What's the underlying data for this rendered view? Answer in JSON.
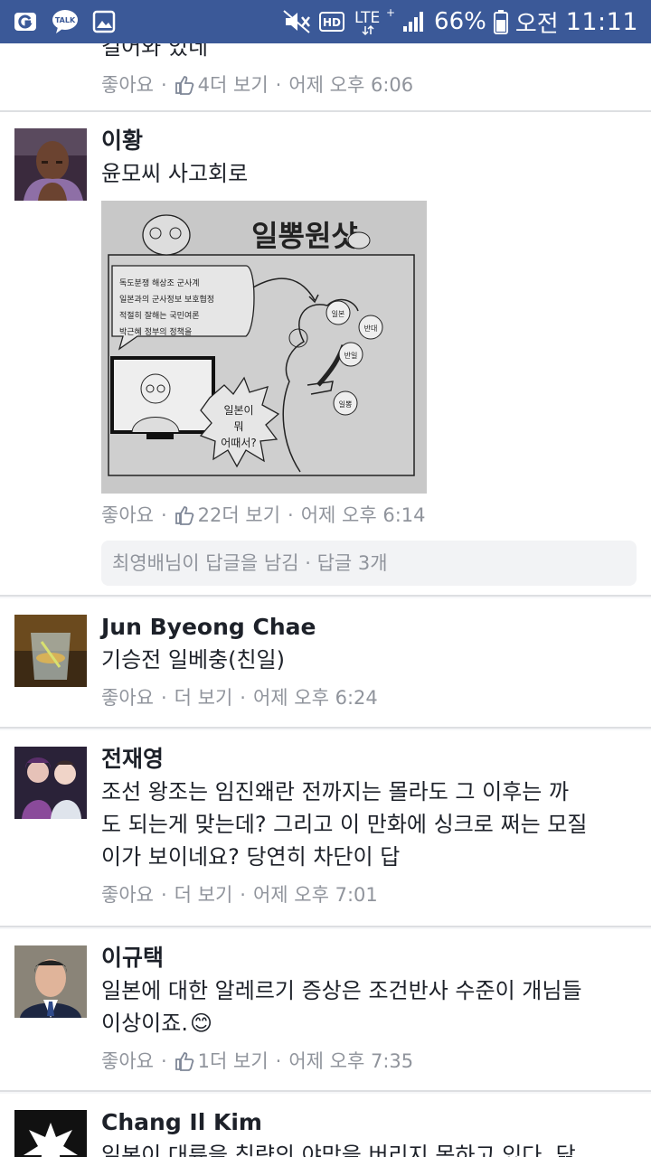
{
  "status_bar": {
    "battery": "66%",
    "network": "LTE",
    "network_sup": "+",
    "hd": "HD",
    "ampm": "오전",
    "time": "11:11",
    "talk": "TALK"
  },
  "top_partial": {
    "text": "걸어와 있네",
    "like": "좋아요",
    "count": "4",
    "more": "더 보기",
    "time": "어제 오후 6:06"
  },
  "comments": [
    {
      "author": "이황",
      "text": "윤모씨 사고회로",
      "like": "좋아요",
      "count": "22",
      "more": "더 보기",
      "time": "어제 오후 6:14",
      "reply": "최영배님이 답글을 남김 · 답글 3개",
      "cartoon": {
        "title": "일뽕원샷",
        "lines": [
          "독도분쟁 해상조 군사계",
          "일본과의 군사정보 보호협정",
          "적절히 잘해는 국민여론",
          "박근혜 정부의 정책을"
        ],
        "bubble": [
          "일본이",
          "뭐",
          "어때서?"
        ],
        "labels": [
          "일본",
          "반대",
          "반일",
          "일뽕"
        ]
      }
    },
    {
      "author": "Jun Byeong Chae",
      "text": "기승전 일베충(친일)",
      "like": "좋아요",
      "more": "더 보기",
      "time": "어제 오후 6:24"
    },
    {
      "author": "전재영",
      "text_lines": [
        "조선 왕조는 임진왜란 전까지는 몰라도 그 이후는 까",
        "도 되는게 맞는데? 그리고 이 만화에 싱크로 쩌는 모질",
        "이가 보이네요? 당연히 차단이 답"
      ],
      "like": "좋아요",
      "more": "더 보기",
      "time": "어제 오후 7:01"
    },
    {
      "author": "이규택",
      "text_lines": [
        "일본에 대한 알레르기 증상은 조건반사 수준이 개님들",
        "이상이죠."
      ],
      "emoji": "😊",
      "like": "좋아요",
      "count": "1",
      "more": "더 보기",
      "time": "어제 오후 7:35"
    },
    {
      "author": "Chang Il Kim",
      "text": "일본이 대륙을 침략의 야망을 버리지 못하고 있다. 닭"
    }
  ],
  "colors": {
    "fb_blue": "#3b5998",
    "meta_gray": "#90949c",
    "text": "#1d2129"
  }
}
